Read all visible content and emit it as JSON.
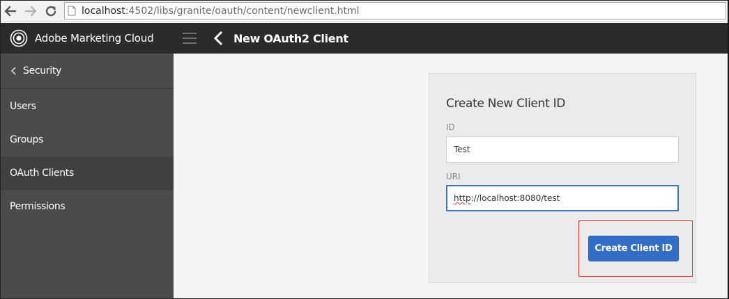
{
  "browser": {
    "url_host": "localhost",
    "url_rest": ":4502/libs/granite/oauth/content/newclient.html"
  },
  "header": {
    "brand": "Adobe Marketing Cloud",
    "title": "New OAuth2 Client"
  },
  "sidebar": {
    "back_label": "Security",
    "items": [
      {
        "label": "Users"
      },
      {
        "label": "Groups"
      },
      {
        "label": "OAuth Clients",
        "active": true
      },
      {
        "label": "Permissions"
      }
    ]
  },
  "form": {
    "title": "Create New Client ID",
    "id_label": "ID",
    "id_value": "Test",
    "uri_label": "URI",
    "uri_value_scheme": "http",
    "uri_value_rest": "://localhost:8080/test",
    "submit_label": "Create Client ID"
  },
  "colors": {
    "accent": "#326ec8",
    "header_bg": "#2b2b2b",
    "sidebar_bg": "#4b4b4b",
    "highlight": "#d9302c"
  }
}
